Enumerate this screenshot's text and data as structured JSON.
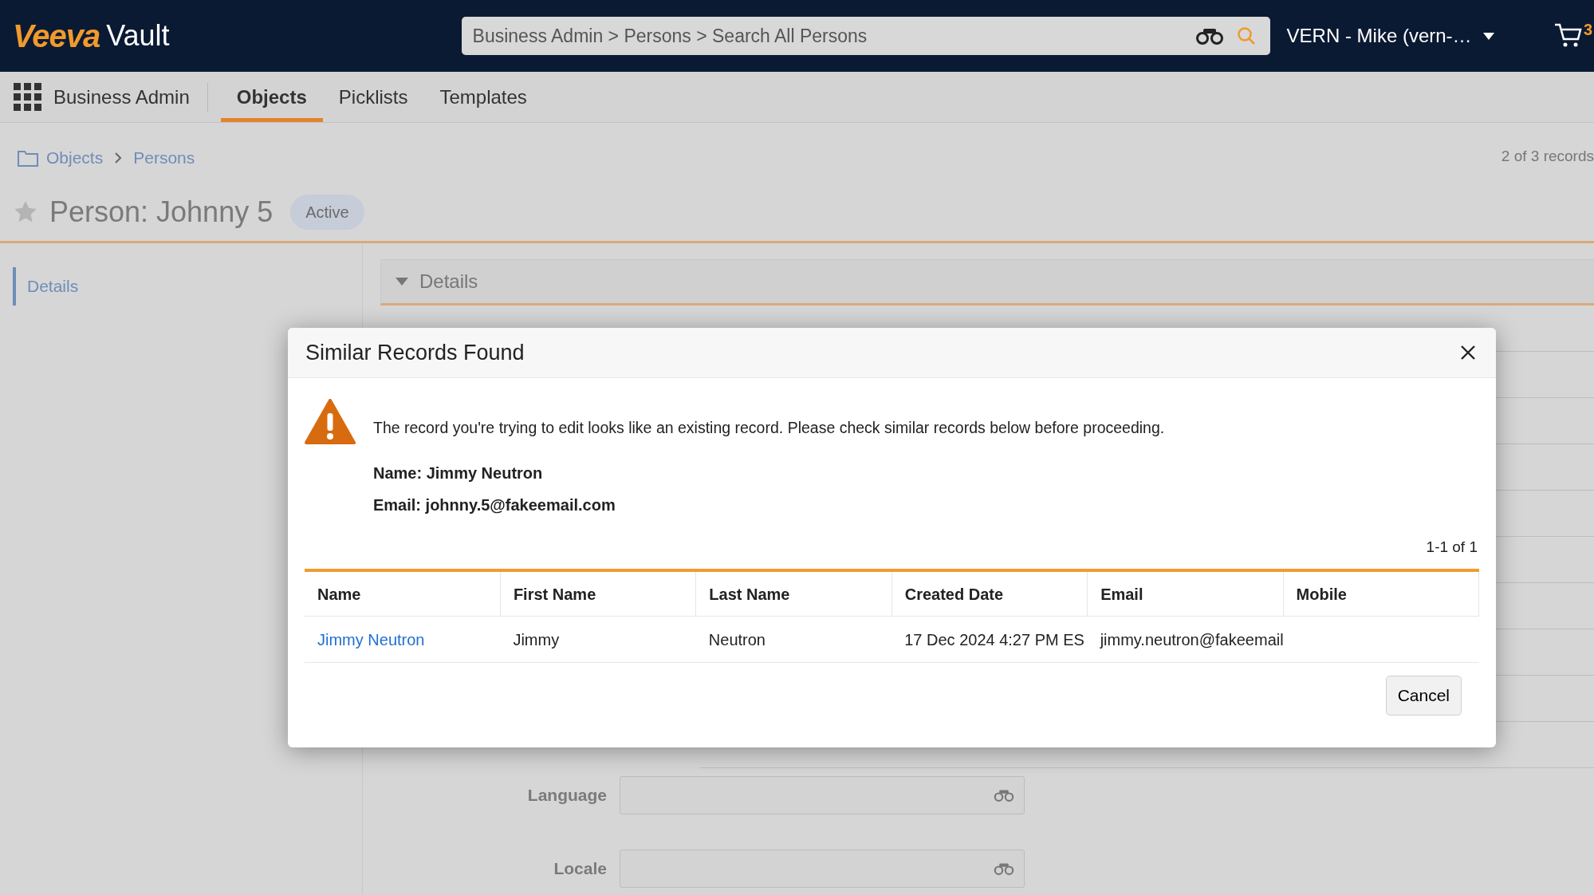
{
  "header": {
    "logo": "Veeva",
    "product": "Vault",
    "search": {
      "value": "Business Admin > Persons > Search All Persons"
    },
    "user": "VERN - Mike (vern-…",
    "cart_count": "3"
  },
  "nav": {
    "app_name": "Business Admin",
    "tabs": [
      {
        "label": "Objects",
        "selected": true
      },
      {
        "label": "Picklists",
        "selected": false
      },
      {
        "label": "Templates",
        "selected": false
      }
    ]
  },
  "breadcrumb": [
    "Objects",
    "Persons"
  ],
  "record_count": "2 of 3 records",
  "record": {
    "title": "Person: Johnny 5",
    "favorite": false,
    "status": "Active"
  },
  "sidebar": {
    "items": [
      {
        "label": "Details",
        "selected": true
      }
    ]
  },
  "section": {
    "title": "Details",
    "expanded": true
  },
  "fields": [
    {
      "label": "Language"
    },
    {
      "label": "Locale"
    }
  ],
  "dialog": {
    "title": "Similar Records Found",
    "message": "The record you're trying to edit looks like an existing record. Please check similar records below before proceeding.",
    "details": [
      "Name: Jimmy Neutron",
      "Email: johnny.5@fakeemail.com"
    ],
    "pagination": "1-1 of 1",
    "table": {
      "columns": [
        "Name",
        "First Name",
        "Last Name",
        "Created Date",
        "Email",
        "Mobile"
      ],
      "rows": [
        {
          "cells": [
            "Jimmy Neutron",
            "Jimmy",
            "Neutron",
            "17 Dec 2024 4:27 PM ES",
            "jimmy.neutron@fakeemail",
            ""
          ]
        }
      ]
    },
    "buttons": [
      "Cancel"
    ]
  }
}
